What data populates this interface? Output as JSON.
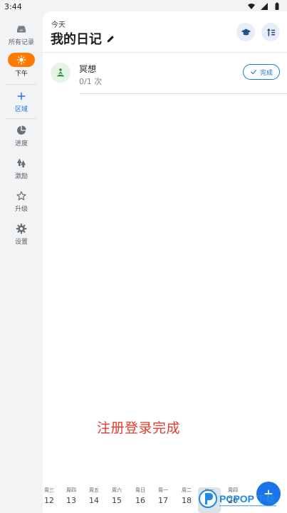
{
  "status_bar": {
    "time": "3:44"
  },
  "sidebar": {
    "items": [
      {
        "label": "所有记录",
        "icon": "inbox-icon"
      },
      {
        "label": "下午",
        "icon": "sun-icon"
      },
      {
        "label": "区域",
        "icon": "add-icon"
      },
      {
        "label": "进度",
        "icon": "pie-chart-icon"
      },
      {
        "label": "激励",
        "icon": "trees-icon"
      },
      {
        "label": "升级",
        "icon": "star-icon"
      },
      {
        "label": "设置",
        "icon": "gear-icon"
      }
    ],
    "accent_color": "#ff7a00"
  },
  "header": {
    "subtitle": "今天",
    "title": "我的日记"
  },
  "habits": [
    {
      "name": "冥想",
      "progress": "0/1 次",
      "action_label": "完成"
    }
  ],
  "caption": "注册登录完成",
  "date_strip": [
    {
      "weekday": "周三",
      "day": "12"
    },
    {
      "weekday": "周四",
      "day": "13"
    },
    {
      "weekday": "周五",
      "day": "14"
    },
    {
      "weekday": "周六",
      "day": "15"
    },
    {
      "weekday": "周日",
      "day": "16"
    },
    {
      "weekday": "周一",
      "day": "17"
    },
    {
      "weekday": "周二",
      "day": "18"
    },
    {
      "weekday": "周三",
      "day": "19"
    },
    {
      "weekday": "周四",
      "day": "20"
    }
  ],
  "watermark": {
    "text": "PCPOP下载",
    "color": "#1e88e5"
  },
  "colors": {
    "primary": "#1a73e8",
    "caption": "#e33b2e"
  }
}
